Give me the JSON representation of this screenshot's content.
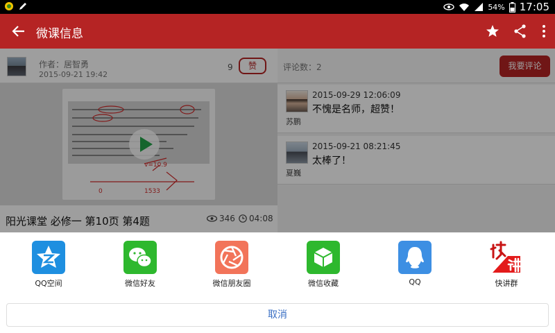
{
  "status_bar": {
    "battery": "54%",
    "time": "17:05"
  },
  "app_bar": {
    "title": "微课信息"
  },
  "author": {
    "name": "作者：居智勇",
    "date": "2015-09-21 19:42",
    "likes": "9",
    "like_label": "赞"
  },
  "video": {
    "title": "阳光课堂 必修一 第10页 第4题",
    "views": "346",
    "duration": "04:08"
  },
  "comments_panel": {
    "count_label": "评论数：2",
    "comment_button": "我要评论",
    "items": [
      {
        "date": "2015-09-29 12:06:09",
        "text": "不愧是名师，超赞！",
        "user": "苏鹏"
      },
      {
        "date": "2015-09-21 08:21:45",
        "text": "太棒了！",
        "user": "夏巍"
      }
    ]
  },
  "share_sheet": {
    "items": [
      {
        "label": "QQ空间",
        "icon": "qzone-icon",
        "color": "#1e8fe0"
      },
      {
        "label": "微信好友",
        "icon": "wechat-icon",
        "color": "#2eb82e"
      },
      {
        "label": "微信朋友圈",
        "icon": "moments-icon",
        "color": "#f2745a"
      },
      {
        "label": "微信收藏",
        "icon": "favorites-icon",
        "color": "#2eb82e"
      },
      {
        "label": "QQ",
        "icon": "qq-icon",
        "color": "#3d8fe3"
      },
      {
        "label": "快讲群",
        "icon": "kuaijiang-icon",
        "color": "#e31b1b"
      }
    ],
    "cancel_label": "取消"
  },
  "colors": {
    "brand": "#b52424",
    "cancel_text": "#3a6fc4"
  }
}
